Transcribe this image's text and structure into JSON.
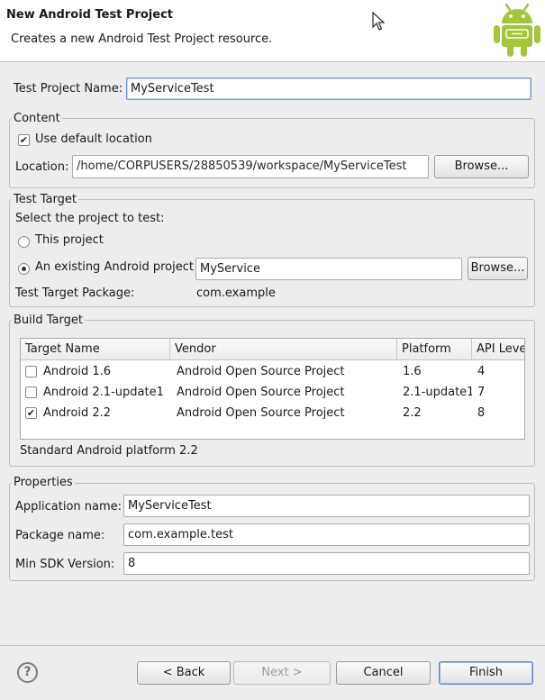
{
  "banner": {
    "title": "New Android Test Project",
    "description": "Creates a new Android Test Project resource."
  },
  "test_project_name": {
    "label": "Test Project Name:",
    "value": "MyServiceTest"
  },
  "content": {
    "title": "Content",
    "use_default_label": "Use default location",
    "use_default_checked": true,
    "location_label": "Location:",
    "location_value": "/home/CORPUSERS/28850539/workspace/MyServiceTest",
    "browse_label": "Browse..."
  },
  "test_target": {
    "title": "Test Target",
    "prompt": "Select the project to test:",
    "this_project_label": "This project",
    "existing_label": "An existing Android project",
    "selected": "existing",
    "existing_value": "MyService",
    "browse_label": "Browse...",
    "package_label": "Test Target Package:",
    "package_value": "com.example"
  },
  "build_target": {
    "title": "Build Target",
    "columns": [
      "Target Name",
      "Vendor",
      "Platform",
      "API Leve"
    ],
    "rows": [
      {
        "name": "Android 1.6",
        "vendor": "Android Open Source Project",
        "platform": "1.6",
        "api": "4",
        "checked": false
      },
      {
        "name": "Android 2.1-update1",
        "vendor": "Android Open Source Project",
        "platform": "2.1-update1",
        "api": "7",
        "checked": false
      },
      {
        "name": "Android 2.2",
        "vendor": "Android Open Source Project",
        "platform": "2.2",
        "api": "8",
        "checked": true
      }
    ],
    "description": "Standard Android platform 2.2"
  },
  "properties": {
    "title": "Properties",
    "app_name_label": "Application name:",
    "app_name_value": "MyServiceTest",
    "package_label": "Package name:",
    "package_value": "com.example.test",
    "min_sdk_label": "Min SDK Version:",
    "min_sdk_value": "8"
  },
  "footer": {
    "help_symbol": "?",
    "back_label": "< Back",
    "next_label": "Next >",
    "cancel_label": "Cancel",
    "finish_label": "Finish"
  },
  "colors": {
    "android_green": "#a4c639",
    "dialog_bg": "#ededed",
    "focus_border": "#6f95c8"
  },
  "icons": [
    "android-logo-icon",
    "mouse-cursor-icon",
    "help-icon",
    "checkmark-icon"
  ]
}
